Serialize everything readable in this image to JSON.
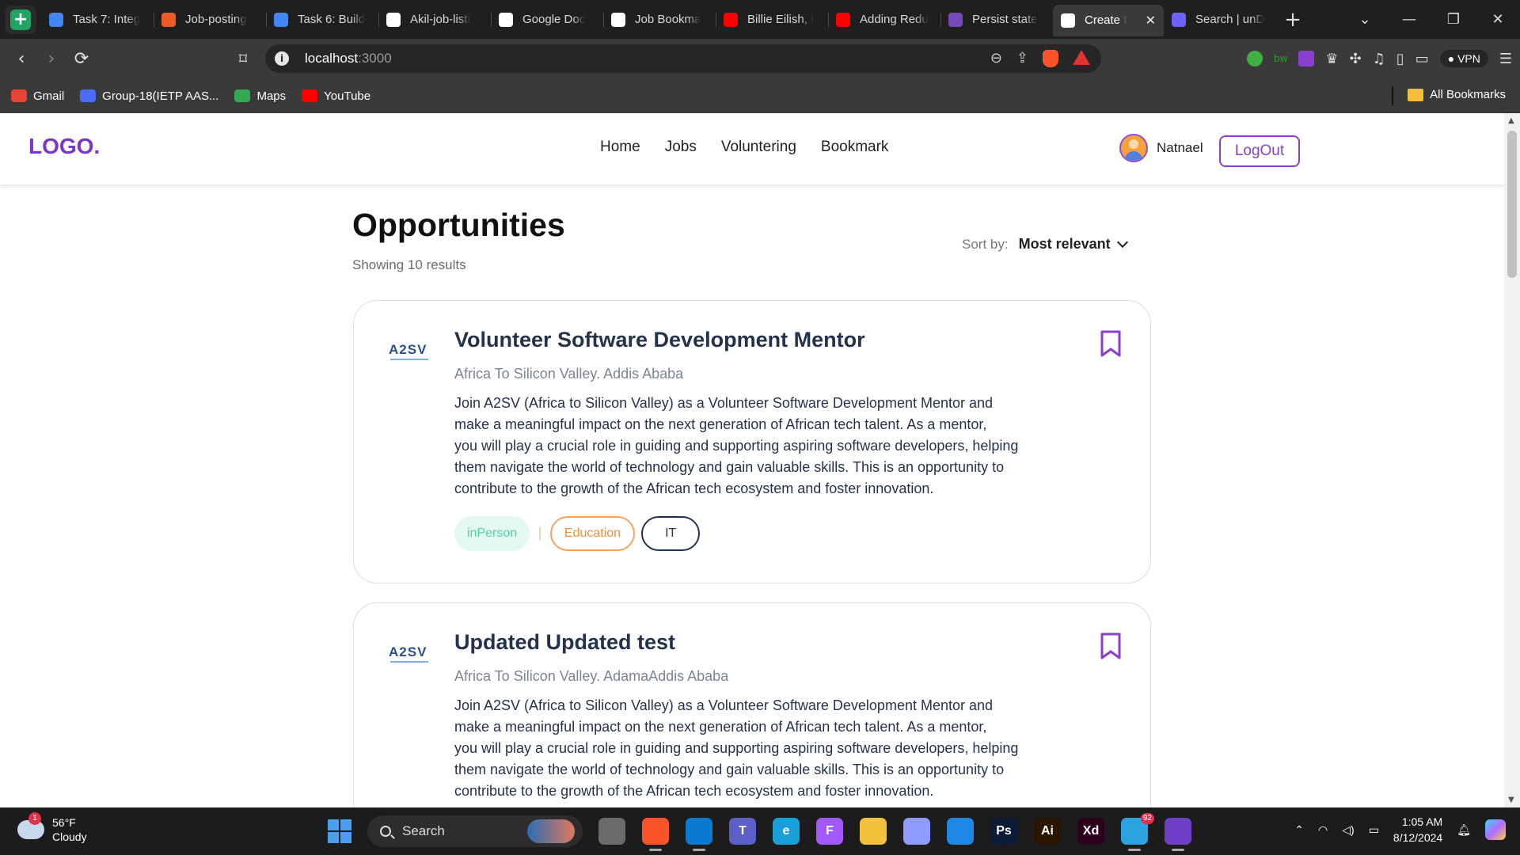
{
  "browser": {
    "tabs": [
      {
        "title": "Task 7: Integ",
        "icon": "docs-icon",
        "color": "#4285f4"
      },
      {
        "title": "Job-posting",
        "icon": "postman-icon",
        "color": "#ef5b25"
      },
      {
        "title": "Task 6: Build",
        "icon": "docs-icon",
        "color": "#4285f4"
      },
      {
        "title": "Akil-job-listi",
        "icon": "github-icon",
        "color": "#ffffff"
      },
      {
        "title": "Google Doc",
        "icon": "google-icon",
        "color": "#ffffff"
      },
      {
        "title": "Job Bookma",
        "icon": "chatgpt-icon",
        "color": "#ffffff"
      },
      {
        "title": "Billie Eilish, I",
        "icon": "youtube-icon",
        "color": "#ff0000"
      },
      {
        "title": "Adding Redu",
        "icon": "youtube-icon",
        "color": "#ff0000"
      },
      {
        "title": "Persist state",
        "icon": "redux-icon",
        "color": "#764abc"
      },
      {
        "title": "Create I",
        "icon": "vercel-icon",
        "color": "#ffffff",
        "active": true
      },
      {
        "title": "Search | unD",
        "icon": "undraw-icon",
        "color": "#6c63ff"
      }
    ],
    "url_host": "localhost",
    "url_port": ":3000",
    "bookmarks": [
      {
        "label": "Gmail",
        "color": "#ea4335"
      },
      {
        "label": "Group-18(IETP AAS...",
        "color": "#4a6cf7"
      },
      {
        "label": "Maps",
        "color": "#34a853"
      },
      {
        "label": "YouTube",
        "color": "#ff0000"
      }
    ],
    "all_bookmarks": "All Bookmarks",
    "vpn": "VPN"
  },
  "header": {
    "logo": "LOGO.",
    "nav": [
      "Home",
      "Jobs",
      "Voluntering",
      "Bookmark"
    ],
    "user_name": "Natnael",
    "logout": "LogOut"
  },
  "main": {
    "title": "Opportunities",
    "count": "Showing 10 results",
    "sort_label": "Sort by:",
    "sort_value": "Most relevant"
  },
  "cards": [
    {
      "logo_text": "A2SV",
      "title": "Volunteer Software Development Mentor",
      "org": "Africa To Silicon Valley. Addis Ababa",
      "desc": [
        "Join A2SV (Africa to Silicon Valley) as a Volunteer Software Development Mentor and",
        "make a meaningful impact on the next generation of African tech talent. As a mentor,",
        "you will play a crucial role in guiding and supporting aspiring software developers, helping",
        "them navigate the world of technology and gain valuable skills. This is an opportunity to",
        "contribute to the growth of the African tech ecosystem and foster innovation."
      ],
      "tags": [
        "inPerson",
        "Education",
        "IT"
      ]
    },
    {
      "logo_text": "A2SV",
      "title": "Updated Updated test",
      "org": "Africa To Silicon Valley. AdamaAddis Ababa",
      "desc": [
        "Join A2SV (Africa to Silicon Valley) as a Volunteer Software Development Mentor and",
        "make a meaningful impact on the next generation of African tech talent. As a mentor,",
        "you will play a crucial role in guiding and supporting aspiring software developers, helping",
        "them navigate the world of technology and gain valuable skills. This is an opportunity to",
        "contribute to the growth of the African tech ecosystem and foster innovation."
      ]
    }
  ],
  "taskbar": {
    "weather_temp": "56°F",
    "weather_desc": "Cloudy",
    "weather_badge": "1",
    "search": "Search",
    "apps": [
      {
        "name": "task-view",
        "label": "",
        "color": "#6b6b6b"
      },
      {
        "name": "brave",
        "label": "",
        "color": "#fb542b",
        "active": true
      },
      {
        "name": "vscode",
        "label": "",
        "color": "#0a7ad1",
        "active": true
      },
      {
        "name": "teams",
        "label": "T",
        "color": "#5b5fc7"
      },
      {
        "name": "edge",
        "label": "e",
        "color": "#1aa0d8"
      },
      {
        "name": "figma",
        "label": "F",
        "color": "#a259ff"
      },
      {
        "name": "file-explorer",
        "label": "",
        "color": "#f3c13a"
      },
      {
        "name": "app-store",
        "label": "",
        "color": "#8f9bff"
      },
      {
        "name": "framer",
        "label": "",
        "color": "#1e88e5"
      },
      {
        "name": "photoshop",
        "label": "Ps",
        "color": "#0d1c36"
      },
      {
        "name": "illustrator",
        "label": "Ai",
        "color": "#2a1600"
      },
      {
        "name": "xd",
        "label": "Xd",
        "color": "#2e001e"
      },
      {
        "name": "telegram",
        "label": "",
        "color": "#2aa3e0",
        "active": true
      },
      {
        "name": "github-desktop",
        "label": "",
        "color": "#6e40c9",
        "active": true
      }
    ],
    "telegram_badge": "92",
    "time": "1:05 AM",
    "date": "8/12/2024"
  }
}
